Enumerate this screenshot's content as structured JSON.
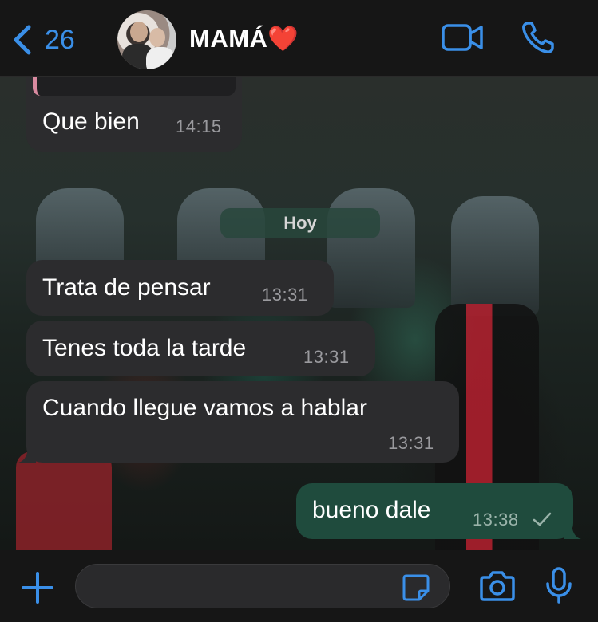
{
  "header": {
    "back_count": "26",
    "contact_name": "MAMÁ❤️",
    "icons": {
      "back": "chevron-left-icon",
      "video": "video-camera-icon",
      "call": "phone-icon"
    }
  },
  "chat": {
    "day_separator": "Hoy",
    "messages": [
      {
        "direction": "incoming",
        "text": "Que bien",
        "time": "14:15"
      },
      {
        "direction": "incoming",
        "text": "Trata de pensar",
        "time": "13:31"
      },
      {
        "direction": "incoming",
        "text": "Tenes toda la tarde",
        "time": "13:31"
      },
      {
        "direction": "incoming",
        "text": "Cuando llegue vamos a hablar",
        "time": "13:31"
      },
      {
        "direction": "outgoing",
        "text": "bueno dale",
        "time": "13:38",
        "status": "sent-check-icon"
      }
    ]
  },
  "composer": {
    "placeholder": "",
    "icons": {
      "add": "plus-icon",
      "sticker": "sticker-icon",
      "camera": "camera-icon",
      "mic": "microphone-icon"
    }
  },
  "colors": {
    "accent": "#3a8fe8",
    "incoming_bubble": "#2c2c2e",
    "outgoing_bubble": "#1f4b3d"
  }
}
